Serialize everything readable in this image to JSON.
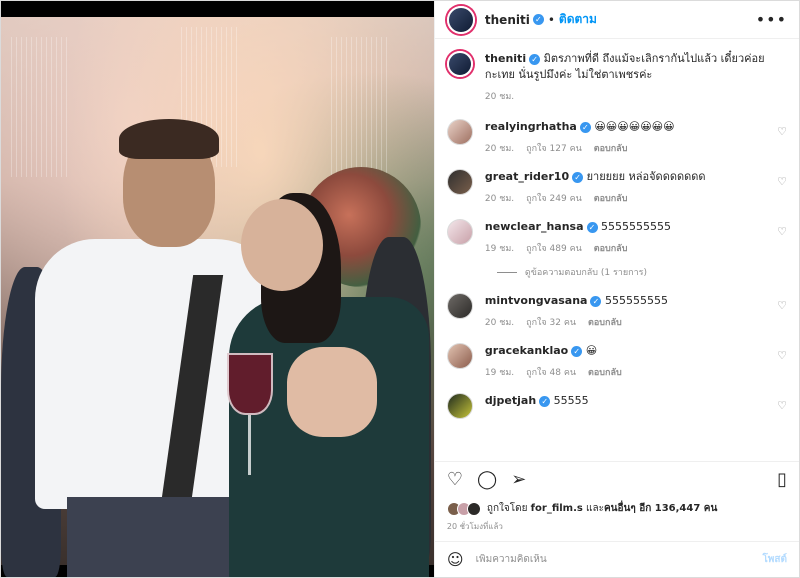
{
  "header": {
    "username": "theniti",
    "separator": "•",
    "follow_label": "ติดตาม",
    "more_icon": "more-horizontal-icon"
  },
  "caption": {
    "username": "theniti",
    "text": "มิตรภาพที่ดี ถึงแม้จะเลิกรากันไปแล้ว เดี๋ยวค่อยกะเทย นั่นรูปมึงค่ะ ไม่ใช่ตาเพชรค่ะ",
    "time": "20 ชม."
  },
  "comments": [
    {
      "username": "realyingrhatha",
      "text": "😀😀😀😀😀😀😀",
      "time": "20 ชม.",
      "likes": "ถูกใจ 127 คน",
      "reply": "ตอบกลับ"
    },
    {
      "username": "great_rider10",
      "text": "ยายยยย หล่อจัดดดดดดด",
      "time": "20 ชม.",
      "likes": "ถูกใจ 249 คน",
      "reply": "ตอบกลับ"
    },
    {
      "username": "newclear_hansa",
      "text": "5555555555",
      "time": "19 ชม.",
      "likes": "ถูกใจ 489 คน",
      "reply": "ตอบกลับ"
    },
    {
      "username": "mintvongvasana",
      "text": "555555555",
      "time": "20 ชม.",
      "likes": "ถูกใจ 32 คน",
      "reply": "ตอบกลับ"
    },
    {
      "username": "gracekanklao",
      "text": "😀",
      "time": "19 ชม.",
      "likes": "ถูกใจ 48 คน",
      "reply": "ตอบกลับ"
    },
    {
      "username": "djpetjah",
      "text": "55555",
      "time": "",
      "likes": "",
      "reply": ""
    }
  ],
  "view_replies": "ดูข้อความตอบกลับ (1 รายการ)",
  "actions": {
    "like_icon": "heart-icon",
    "comment_icon": "comment-icon",
    "share_icon": "share-icon",
    "save_icon": "bookmark-icon"
  },
  "likes_summary": {
    "prefix": "ถูกใจโดย",
    "first_user": "for_film.s",
    "middle": "และ",
    "others": "คนอื่นๆ อีก 136,447 คน"
  },
  "post_time": "20 ชั่วโมงที่แล้ว",
  "add_comment": {
    "placeholder": "เพิ่มความคิดเห็น",
    "post_label": "โพสต์"
  },
  "colors": {
    "accent": "#0095f6",
    "verified": "#3897f0",
    "post_disabled": "#b3dbff"
  }
}
